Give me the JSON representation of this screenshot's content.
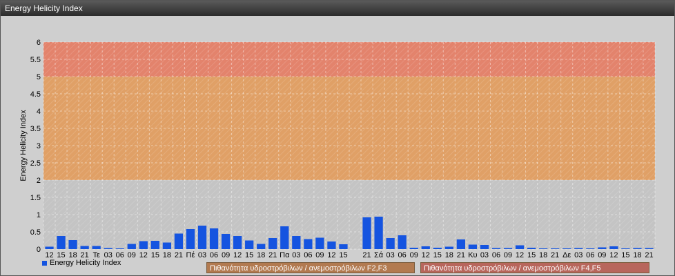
{
  "window": {
    "title": "Energy Helicity Index"
  },
  "colors": {
    "bar": "#1554e0",
    "band_low": "#d19769",
    "band_mid": "#e0a066",
    "band_high": "#e3836c",
    "plot_gray": "#c4c4c4"
  },
  "legend": {
    "series_label": "Energy Helicity Index",
    "band1_label": "Πιθανότητα υδροστρόβιλων / ανεμοστρόβιλων F2,F3",
    "band2_label": "Πιθανότητα υδροστρόβιλων / ανεμοστρόβιλων F4,F5"
  },
  "chart_data": {
    "type": "bar",
    "title": "",
    "xlabel": "",
    "ylabel": "Energy Helicity Index",
    "ylim": [
      0,
      6
    ],
    "yticks": [
      "0",
      "0.5",
      "1",
      "1.5",
      "2",
      "2.5",
      "3",
      "3.5",
      "4",
      "4.5",
      "5",
      "5.5",
      "6"
    ],
    "bands": [
      {
        "from": 2,
        "to": 5,
        "label": "Πιθανότητα υδροστρόβιλων / ανεμοστρόβιλων F2,F3"
      },
      {
        "from": 5,
        "to": 6,
        "label": "Πιθανότητα υδροστρόβιλων / ανεμοστρόβιλων F4,F5"
      }
    ],
    "categories": [
      "12",
      "15",
      "18",
      "21",
      "Τε",
      "03",
      "06",
      "09",
      "12",
      "15",
      "18",
      "21",
      "Πέ",
      "03",
      "06",
      "09",
      "12",
      "15",
      "18",
      "21",
      "Πα",
      "03",
      "06",
      "09",
      "12",
      "15",
      "",
      "21",
      "Σά",
      "03",
      "06",
      "09",
      "12",
      "15",
      "18",
      "21",
      "Κυ",
      "03",
      "06",
      "09",
      "12",
      "15",
      "18",
      "21",
      "Δε",
      "03",
      "06",
      "09",
      "12",
      "15",
      "18",
      "21"
    ],
    "series": [
      {
        "name": "Energy Helicity Index",
        "values": [
          0.07,
          0.38,
          0.26,
          0.09,
          0.09,
          0.03,
          0.02,
          0.15,
          0.23,
          0.24,
          0.19,
          0.45,
          0.58,
          0.68,
          0.6,
          0.44,
          0.38,
          0.25,
          0.15,
          0.32,
          0.66,
          0.38,
          0.29,
          0.33,
          0.22,
          0.14,
          0.0,
          0.92,
          0.94,
          0.32,
          0.4,
          0.04,
          0.08,
          0.04,
          0.07,
          0.28,
          0.13,
          0.12,
          0.03,
          0.03,
          0.11,
          0.04,
          0.02,
          0.02,
          0.02,
          0.03,
          0.02,
          0.05,
          0.08,
          0.02,
          0.03,
          0.03
        ]
      }
    ],
    "grid": true,
    "legend_position": "bottom-left"
  }
}
